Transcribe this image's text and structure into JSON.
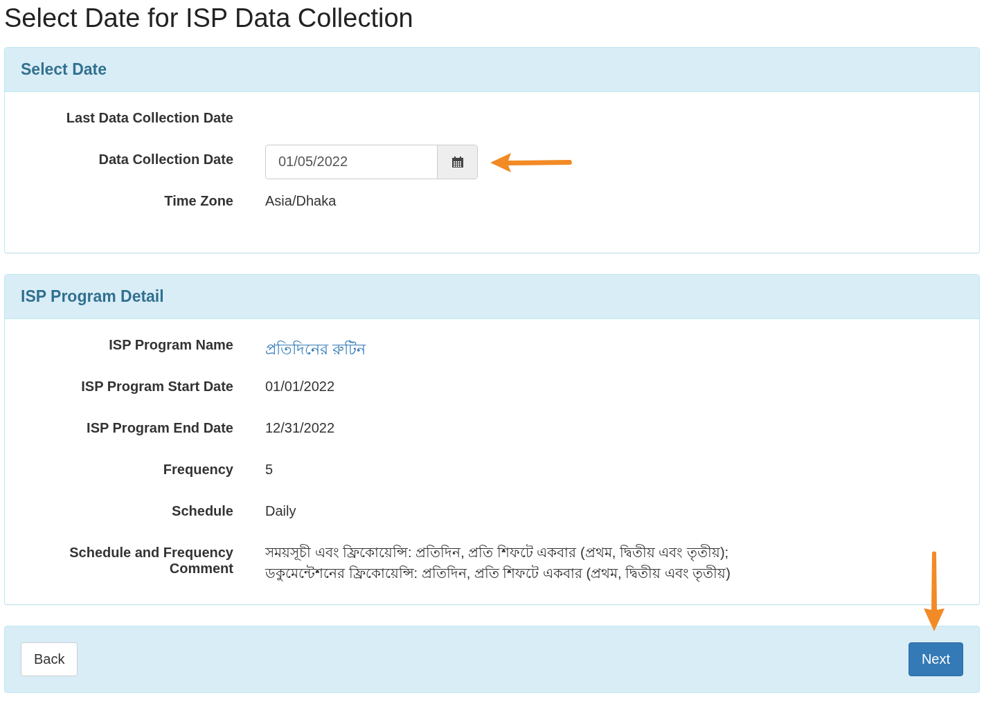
{
  "page_title": "Select Date for ISP Data Collection",
  "panels": [
    {
      "title": "Select Date",
      "rows": [
        {
          "label": "Last Data Collection Date",
          "kind": "text"
        },
        {
          "label": "Data Collection Date",
          "kind": "date",
          "value": "01/05/2022"
        },
        {
          "label": "Time Zone",
          "kind": "text",
          "value": "Asia/Dhaka"
        }
      ]
    },
    {
      "title": "ISP Program Detail",
      "rows": [
        {
          "label": "ISP Program Name",
          "kind": "link",
          "value": "প্রতিদিনের রুটিন"
        },
        {
          "label": "ISP Program Start Date",
          "kind": "text",
          "value": "01/01/2022"
        },
        {
          "label": "ISP Program End Date",
          "kind": "text",
          "value": "12/31/2022"
        },
        {
          "label": "Frequency",
          "kind": "text",
          "value": "5"
        },
        {
          "label": "Schedule",
          "kind": "text",
          "value": "Daily"
        },
        {
          "label": "Schedule and Frequency Comment",
          "kind": "lines",
          "lines": [
            "সময়সূচী এবং ফ্রিকোয়েন্সি: প্রতিদিন, প্রতি শিফটে একবার (প্রথম, দ্বিতীয় এবং তৃতীয়);",
            "ডকুমেন্টেশনের ফ্রিকোয়েন্সি: প্রতিদিন, প্রতি শিফটে একবার (প্রথম, দ্বিতীয় এবং তৃতীয়)"
          ]
        }
      ]
    }
  ],
  "footer": {
    "back": "Back",
    "next": "Next"
  }
}
